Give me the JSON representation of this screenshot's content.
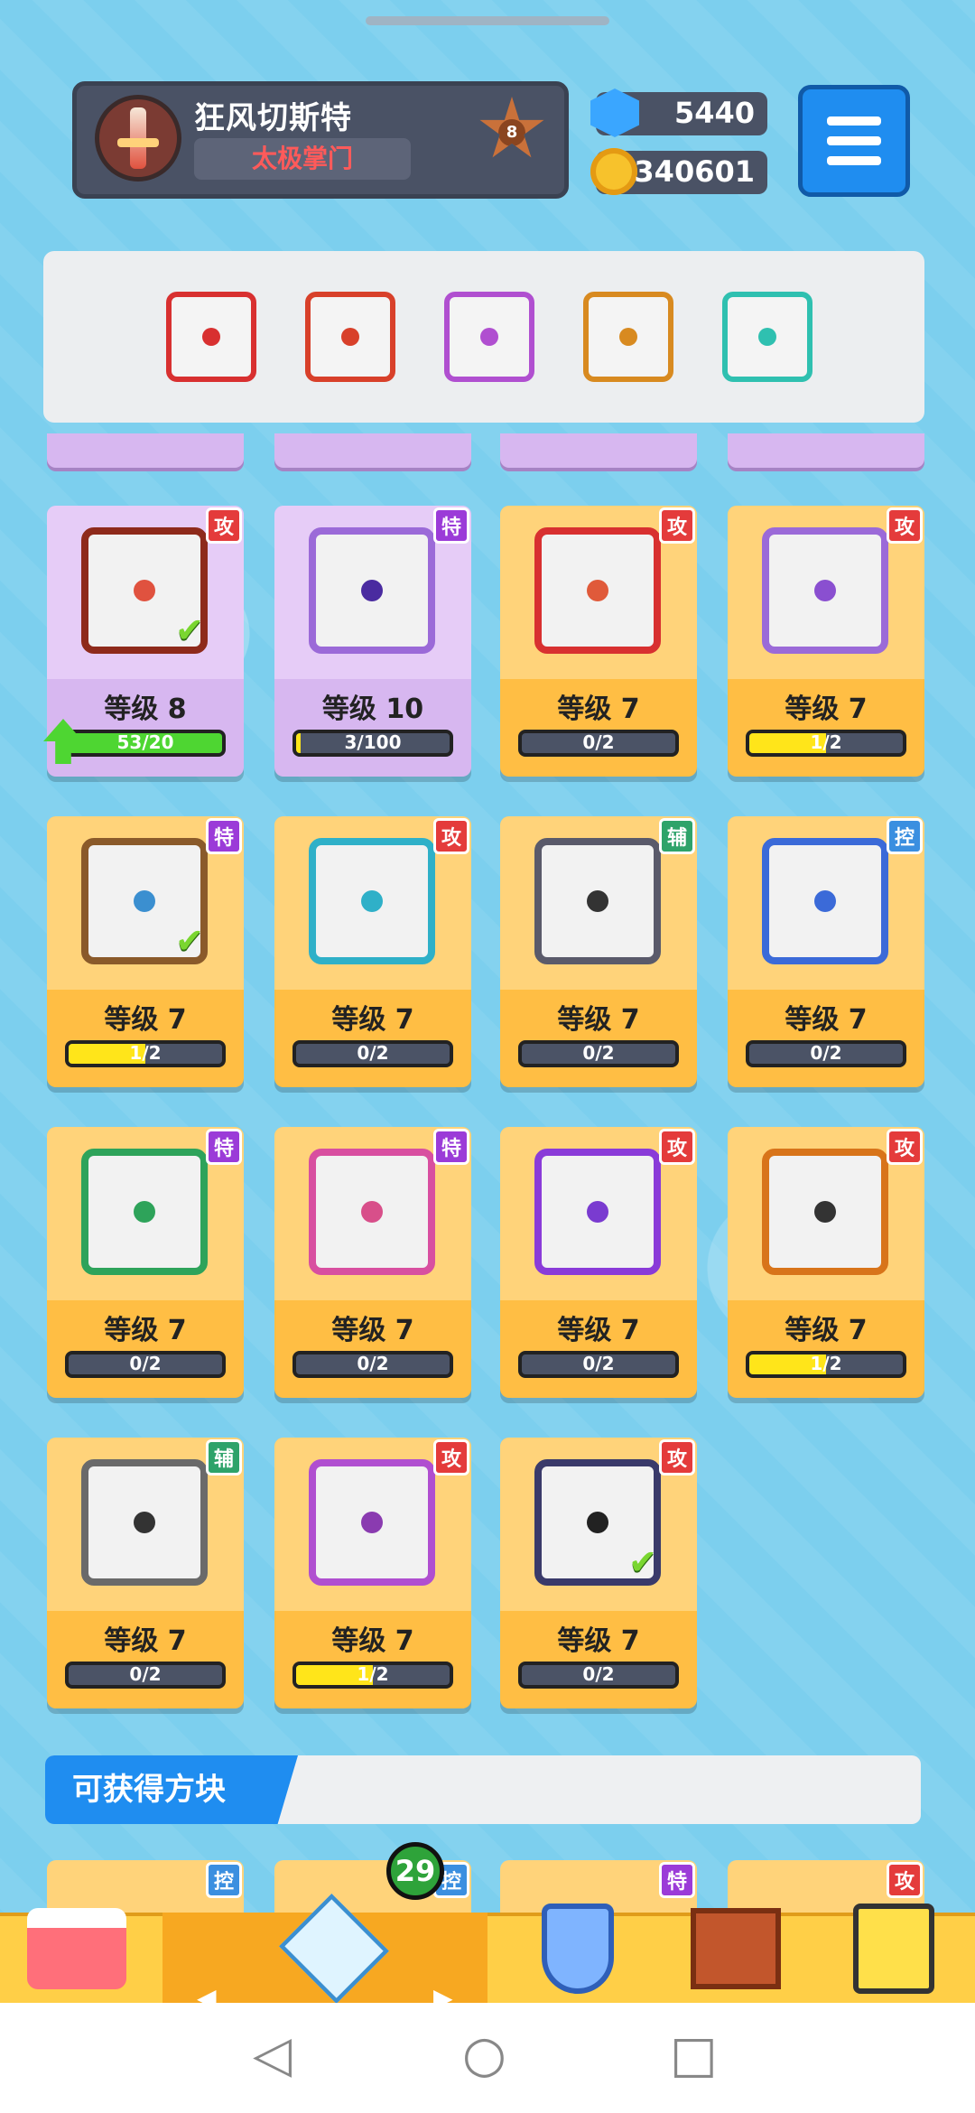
{
  "player": {
    "name": "狂风切斯特",
    "title": "太极掌门",
    "rank": "8"
  },
  "currency": {
    "gems": "5440",
    "coins": "340601"
  },
  "deck": {
    "slots": [
      {
        "icon": "dragon-blade-icon",
        "color": "#d83030"
      },
      {
        "icon": "fire-phoenix-icon",
        "color": "#d8402a"
      },
      {
        "icon": "purple-orb-icon",
        "color": "#b04fd0"
      },
      {
        "icon": "infinity-dragon-icon",
        "color": "#d88a20"
      },
      {
        "icon": "healing-hands-icon",
        "color": "#2fc0b0"
      }
    ]
  },
  "cards": [
    {
      "level": "等级 8",
      "progress": "53/20",
      "progress_ratio": 1.0,
      "badge": "攻",
      "badge_color": "#e43b3b",
      "frame": "#8e2a1b",
      "dot": "#e0523f",
      "theme": "purple",
      "check": true,
      "upgrade": true,
      "icon": "fire-phoenix-icon"
    },
    {
      "level": "等级 10",
      "progress": "3/100",
      "progress_ratio": 0.03,
      "badge": "特",
      "badge_color": "#9b3bd8",
      "frame": "#9b6ad8",
      "dot": "#4a2ba0",
      "theme": "purple",
      "check": false,
      "upgrade": false,
      "icon": "lightning-orb-icon"
    },
    {
      "level": "等级 7",
      "progress": "0/2",
      "progress_ratio": 0,
      "badge": "攻",
      "badge_color": "#e43b3b",
      "frame": "#d83030",
      "dot": "#e05a3a",
      "theme": "gold",
      "check": false,
      "upgrade": false,
      "icon": "sun-star-icon"
    },
    {
      "level": "等级 7",
      "progress": "1/2",
      "progress_ratio": 0.5,
      "badge": "攻",
      "badge_color": "#e43b3b",
      "frame": "#9b6ad8",
      "dot": "#8a4fd0",
      "theme": "gold",
      "check": false,
      "upgrade": false,
      "icon": "purple-rune-icon"
    },
    {
      "level": "等级 7",
      "progress": "1/2",
      "progress_ratio": 0.5,
      "badge": "特",
      "badge_color": "#9b3bd8",
      "frame": "#8a5a2a",
      "dot": "#3b8fd0",
      "theme": "gold",
      "check": true,
      "upgrade": false,
      "icon": "infinity-icon"
    },
    {
      "level": "等级 7",
      "progress": "0/2",
      "progress_ratio": 0,
      "badge": "攻",
      "badge_color": "#e43b3b",
      "frame": "#2fb0c8",
      "dot": "#2fb0c8",
      "theme": "gold",
      "check": false,
      "upgrade": false,
      "icon": "ice-trident-icon"
    },
    {
      "level": "等级 7",
      "progress": "0/2",
      "progress_ratio": 0,
      "badge": "辅",
      "badge_color": "#2ea36a",
      "frame": "#5a5a6a",
      "dot": "#333333",
      "theme": "gold",
      "check": false,
      "upgrade": false,
      "icon": "fang-mouth-icon"
    },
    {
      "level": "等级 7",
      "progress": "0/2",
      "progress_ratio": 0,
      "badge": "控",
      "badge_color": "#3b8fe0",
      "frame": "#3b6ad8",
      "dot": "#3b6ad8",
      "theme": "gold",
      "check": false,
      "upgrade": false,
      "icon": "snowflake-icon"
    },
    {
      "level": "等级 7",
      "progress": "0/2",
      "progress_ratio": 0,
      "badge": "特",
      "badge_color": "#9b3bd8",
      "frame": "#2ea35a",
      "dot": "#2ea35a",
      "theme": "gold",
      "check": false,
      "upgrade": false,
      "icon": "pentagram-icon"
    },
    {
      "level": "等级 7",
      "progress": "0/2",
      "progress_ratio": 0,
      "badge": "特",
      "badge_color": "#9b3bd8",
      "frame": "#d84fa0",
      "dot": "#d84f8a",
      "theme": "gold",
      "check": false,
      "upgrade": false,
      "icon": "crossed-swords-icon"
    },
    {
      "level": "等级 7",
      "progress": "0/2",
      "progress_ratio": 0,
      "badge": "攻",
      "badge_color": "#e43b3b",
      "frame": "#8a3bd8",
      "dot": "#7a3bd0",
      "theme": "gold",
      "check": false,
      "upgrade": false,
      "icon": "atom-icon"
    },
    {
      "level": "等级 7",
      "progress": "1/2",
      "progress_ratio": 0.5,
      "badge": "攻",
      "badge_color": "#e43b3b",
      "frame": "#d8741a",
      "dot": "#333333",
      "theme": "gold",
      "check": false,
      "upgrade": false,
      "icon": "pistol-icon"
    },
    {
      "level": "等级 7",
      "progress": "0/2",
      "progress_ratio": 0,
      "badge": "辅",
      "badge_color": "#2ea36a",
      "frame": "#6a6a6a",
      "dot": "#333333",
      "theme": "gold",
      "check": false,
      "upgrade": false,
      "icon": "clock-icon"
    },
    {
      "level": "等级 7",
      "progress": "1/2",
      "progress_ratio": 0.5,
      "badge": "攻",
      "badge_color": "#e43b3b",
      "frame": "#b04fd0",
      "dot": "#8a3bb0",
      "theme": "gold",
      "check": false,
      "upgrade": false,
      "icon": "star-icon"
    },
    {
      "level": "等级 7",
      "progress": "0/2",
      "progress_ratio": 0,
      "badge": "攻",
      "badge_color": "#e43b3b",
      "frame": "#3a3a6a",
      "dot": "#222222",
      "theme": "gold",
      "check": true,
      "upgrade": false,
      "icon": "black-hole-icon"
    }
  ],
  "obtainable": {
    "label": "可获得方块",
    "peek_badges": [
      "控",
      "控",
      "特",
      "攻"
    ]
  },
  "nav": {
    "count_badge": "29",
    "items": [
      "shop-icon",
      "dice-cube-icon",
      "shield-sword-icon",
      "fortress-icon",
      "hero-icon"
    ]
  }
}
